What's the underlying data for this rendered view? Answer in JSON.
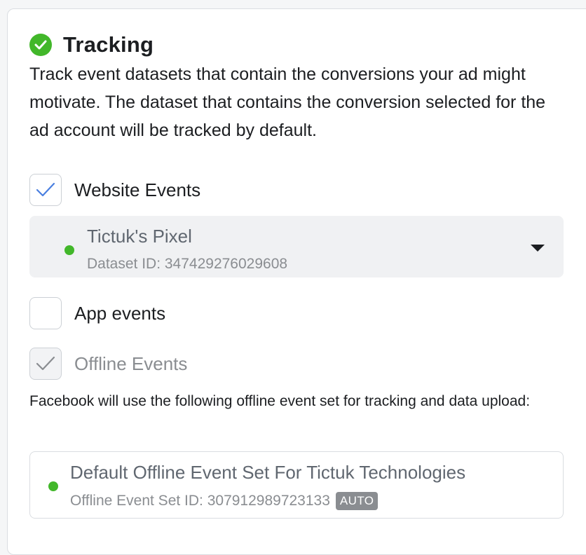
{
  "section": {
    "title": "Tracking",
    "description": "Track event datasets that contain the conversions your ad might motivate. The dataset that contains the conversion selected for the ad account will be tracked by default."
  },
  "options": [
    {
      "label": "Website Events",
      "checked": true,
      "disabled": false
    },
    {
      "label": "App events",
      "checked": false,
      "disabled": false
    },
    {
      "label": "Offline Events",
      "checked": true,
      "disabled": true
    }
  ],
  "dataset_select": {
    "name": "Tictuk's Pixel",
    "id_text": "Dataset ID: 347429276029608"
  },
  "offline_note": "Facebook will use the following offline event set for tracking and data upload:",
  "offline_set": {
    "name": "Default Offline Event Set For Tictuk Technologies",
    "id_text": "Offline Event Set ID: 307912989723133",
    "badge": "AUTO"
  },
  "colors": {
    "success": "#42b72a",
    "check_blue": "#4a7fe0",
    "check_gray": "#8a8d91"
  }
}
